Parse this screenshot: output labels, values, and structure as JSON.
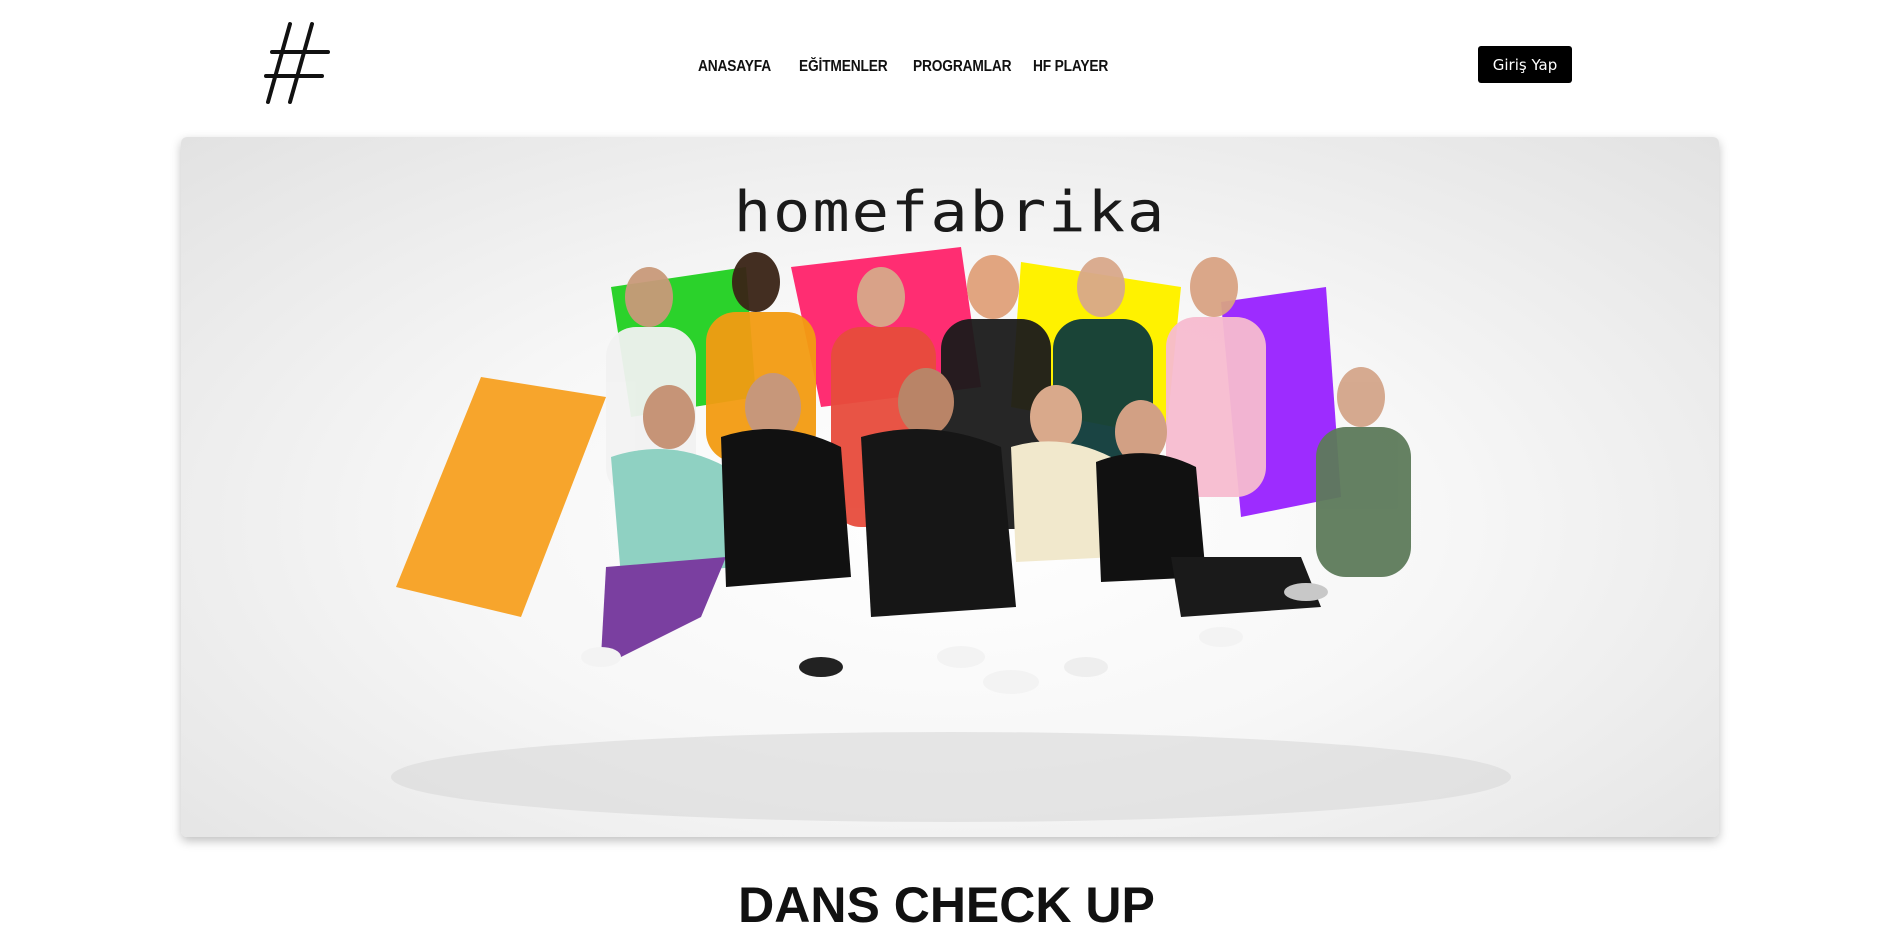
{
  "header": {
    "logo_icon": "hash-logo-icon",
    "nav": [
      {
        "label": "ANASAYFA"
      },
      {
        "label": "EĞİTMENLER"
      },
      {
        "label": "PROGRAMLAR"
      },
      {
        "label": "HF PLAYER"
      }
    ],
    "login_label": "Giriş Yap"
  },
  "hero": {
    "brand_text": "homefabrika",
    "colors": {
      "orange": "#f5a623",
      "green": "#2ecc2e",
      "pink": "#ff2d6f",
      "yellow": "#ffee00",
      "purple": "#9b30ff"
    }
  },
  "main": {
    "heading": "DANS CHECK UP"
  }
}
